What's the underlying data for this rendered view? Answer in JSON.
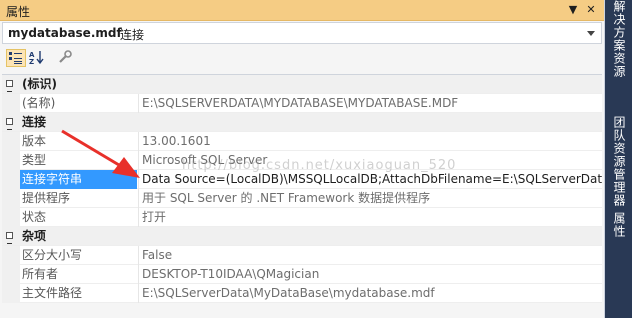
{
  "panel": {
    "title": "属性",
    "controls": [
      "▼",
      "✕"
    ]
  },
  "object": {
    "name": "mydatabase.mdf",
    "type": "连接"
  },
  "toolbar": {
    "buttons": [
      "categorized-icon",
      "alphabetical-icon",
      "property-pages-icon"
    ]
  },
  "grid": {
    "categories": [
      {
        "name": "(标识)",
        "properties": [
          {
            "name": "(名称)",
            "value": "E:\\SQLSERVERDATA\\MYDATABASE\\MYDATABASE.MDF"
          }
        ]
      },
      {
        "name": "连接",
        "properties": [
          {
            "name": "版本",
            "value": "13.00.1601"
          },
          {
            "name": "类型",
            "value": "Microsoft SQL Server"
          },
          {
            "name": "连接字符串",
            "value": "Data Source=(LocalDB)\\MSSQLLocalDB;AttachDbFilename=E:\\SQLServerData\\M"
          },
          {
            "name": "提供程序",
            "value": "用于 SQL Server 的 .NET Framework 数据提供程序"
          },
          {
            "name": "状态",
            "value": "打开"
          }
        ]
      },
      {
        "name": "杂项",
        "properties": [
          {
            "name": "区分大小写",
            "value": "False"
          },
          {
            "name": "所有者",
            "value": "DESKTOP-T10IDAA\\QMagician"
          },
          {
            "name": "主文件路径",
            "value": "E:\\SQLServerData\\MyDataBase\\mydatabase.mdf"
          }
        ]
      }
    ]
  },
  "side_tabs": [
    "解决方案资源管理器",
    "团队资源管理器",
    "属性"
  ],
  "watermark": "http://blog.csdn.net/xuxiaoguan_520",
  "colors": {
    "title_bar": "#f5cc84",
    "selection": "#3399ff",
    "dock_background": "#293955",
    "arrow": "#e8302a"
  }
}
